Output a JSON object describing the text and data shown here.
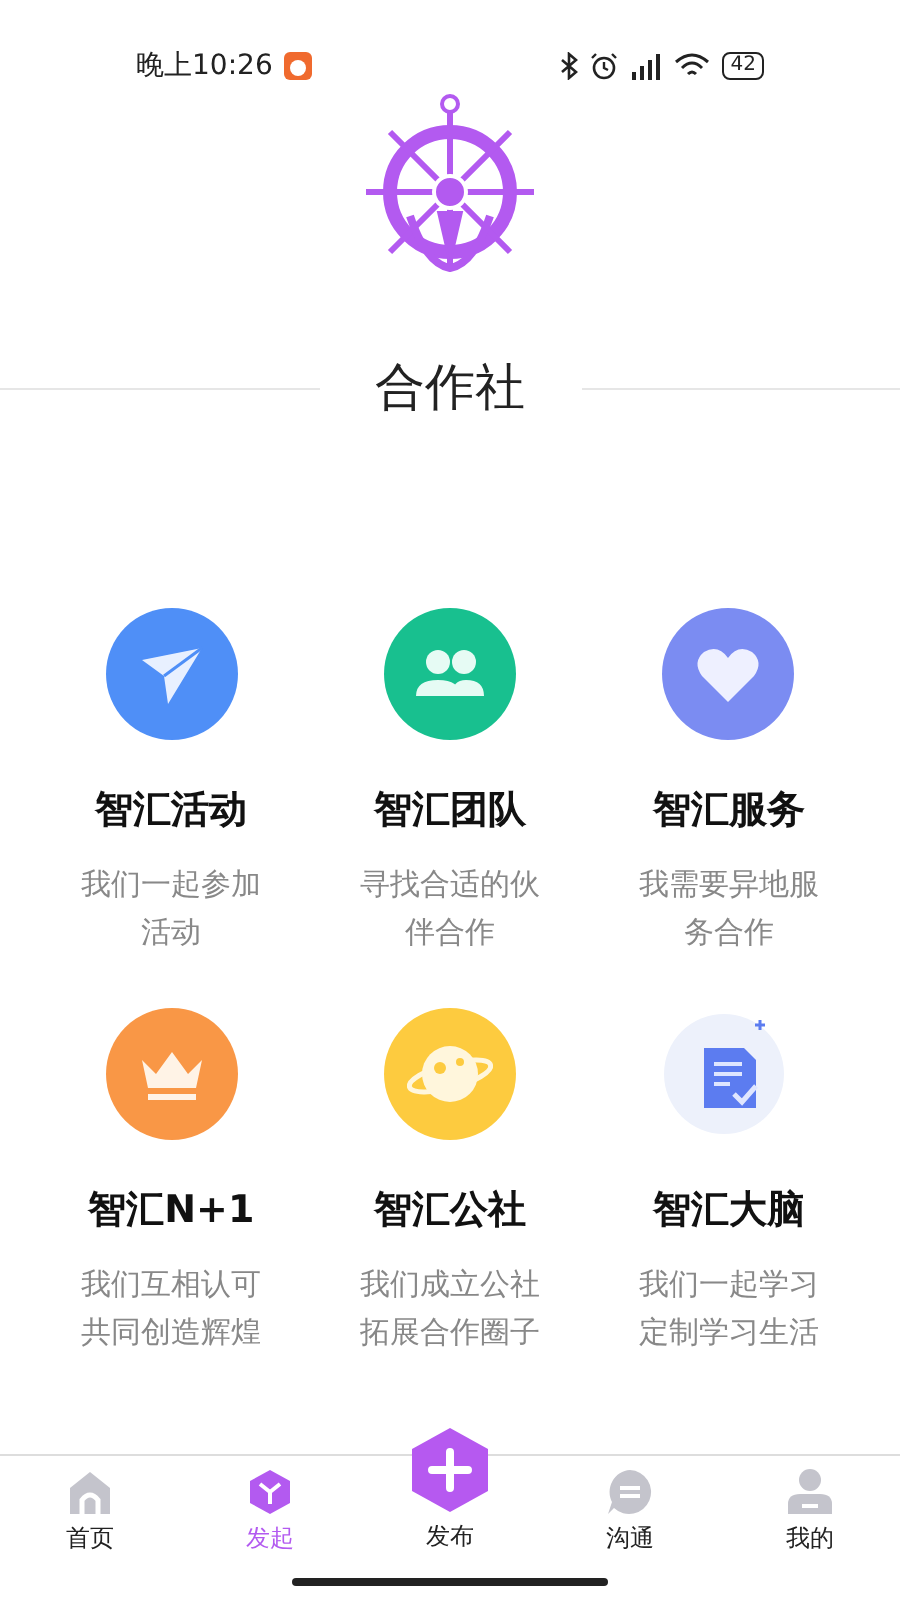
{
  "status_bar": {
    "time": "晚上10:26",
    "battery": "42"
  },
  "title": "合作社",
  "items": [
    {
      "kind": "plane",
      "title": "智汇活动",
      "description": "我们一起参加活动"
    },
    {
      "kind": "team",
      "title": "智汇团队",
      "description": "寻找合适的伙伴合作"
    },
    {
      "kind": "heart",
      "title": "智汇服务",
      "description": "我需要异地服务合作"
    },
    {
      "kind": "crown",
      "title": "智汇N+1",
      "description": "我们互相认可共同创造辉煌"
    },
    {
      "kind": "planet",
      "title": "智汇公社",
      "description": "我们成立公社拓展合作圈子"
    },
    {
      "kind": "document",
      "title": "智汇大脑",
      "description": "我们一起学习定制学习生活"
    }
  ],
  "tabs": [
    {
      "kind": "home",
      "label": "首页",
      "selected": false
    },
    {
      "kind": "cube",
      "label": "发起",
      "selected": true
    },
    {
      "kind": "publish",
      "label": "发布",
      "selected": false
    },
    {
      "kind": "chat",
      "label": "沟通",
      "selected": false
    },
    {
      "kind": "user",
      "label": "我的",
      "selected": false
    }
  ]
}
